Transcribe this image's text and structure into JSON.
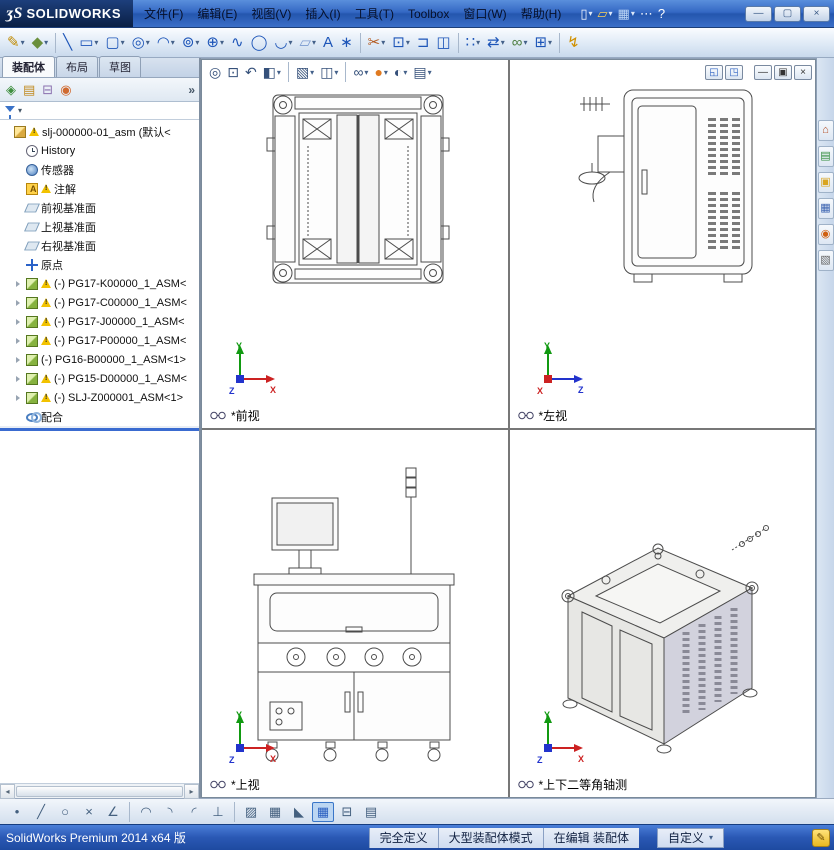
{
  "axis_colors": {
    "X": "#cc2222",
    "Y": "#119911",
    "Z": "#2233cc"
  },
  "titlebar": {
    "logo_mark": "ʒS",
    "logo_text": "SOLIDWORKS",
    "menus": [
      "文件(F)",
      "编辑(E)",
      "视图(V)",
      "插入(I)",
      "工具(T)",
      "Toolbox",
      "窗口(W)",
      "帮助(H)"
    ],
    "quick_icons": [
      {
        "name": "new-document-icon",
        "glyph": "▯",
        "color": "#f5f8ff",
        "caret": true
      },
      {
        "name": "open-document-icon",
        "glyph": "▱",
        "color": "#f7cf5a",
        "caret": true
      },
      {
        "name": "save-icon",
        "glyph": "▦",
        "color": "#bcd6f5",
        "caret": true
      },
      {
        "name": "more-commands-icon",
        "glyph": "⋯",
        "color": "#eaf1fc"
      },
      {
        "name": "help-icon",
        "glyph": "?",
        "color": "#ffffff"
      }
    ],
    "window_buttons": [
      {
        "name": "minimize-button",
        "glyph": "—"
      },
      {
        "name": "maximize-button",
        "glyph": "▢"
      },
      {
        "name": "close-button",
        "glyph": "×"
      }
    ]
  },
  "main_toolbar": {
    "icons": [
      {
        "name": "sketch-icon",
        "glyph": "✎",
        "color": "#c08a00",
        "caret": true
      },
      {
        "name": "dimension-icon",
        "glyph": "◆",
        "color": "#6a8f3c",
        "caret": true
      },
      {
        "sep": true
      },
      {
        "name": "line-icon",
        "glyph": "╲",
        "color": "#1d55b8"
      },
      {
        "name": "rectangle-icon",
        "glyph": "▭",
        "color": "#1d55b8",
        "caret": true
      },
      {
        "name": "slot-icon",
        "glyph": "▢",
        "color": "#1d55b8",
        "caret": true
      },
      {
        "name": "circle-icon",
        "glyph": "◎",
        "color": "#1d55b8",
        "caret": true
      },
      {
        "name": "arc-icon",
        "glyph": "◠",
        "color": "#1d55b8",
        "caret": true
      },
      {
        "name": "spiral-icon",
        "glyph": "⊚",
        "color": "#1d55b8",
        "caret": true
      },
      {
        "name": "perimeter-circle-icon",
        "glyph": "⊕",
        "color": "#1d55b8",
        "caret": true
      },
      {
        "name": "spline-icon",
        "glyph": "∿",
        "color": "#1d55b8"
      },
      {
        "name": "ellipse-icon",
        "glyph": "◯",
        "color": "#1d55b8"
      },
      {
        "name": "fillet-icon",
        "glyph": "◡",
        "color": "#1d55b8",
        "caret": true
      },
      {
        "name": "plane-icon",
        "glyph": "▱",
        "color": "#7a9ad0",
        "caret": true
      },
      {
        "name": "text-icon",
        "glyph": "A",
        "color": "#1d55b8"
      },
      {
        "name": "point-icon",
        "glyph": "∗",
        "color": "#1d55b8"
      },
      {
        "sep": true
      },
      {
        "name": "trim-icon",
        "glyph": "✂",
        "color": "#b35a20",
        "caret": true
      },
      {
        "name": "convert-entities-icon",
        "glyph": "⊡",
        "color": "#1d55b8",
        "caret": true
      },
      {
        "name": "offset-icon",
        "glyph": "⊐",
        "color": "#1d55b8"
      },
      {
        "name": "mirror-icon",
        "glyph": "◫",
        "color": "#1d55b8"
      },
      {
        "sep": true
      },
      {
        "name": "linear-pattern-icon",
        "glyph": "∷",
        "color": "#1d55b8",
        "caret": true
      },
      {
        "name": "move-entities-icon",
        "glyph": "⇄",
        "color": "#1d55b8",
        "caret": true
      },
      {
        "name": "display-relations-icon",
        "glyph": "∞",
        "color": "#4a7c3f",
        "caret": true
      },
      {
        "name": "quick-snaps-icon",
        "glyph": "⊞",
        "color": "#1d55b8",
        "caret": true
      },
      {
        "sep": true
      },
      {
        "name": "rapid-sketch-icon",
        "glyph": "↯",
        "color": "#d09000"
      }
    ]
  },
  "left_panel": {
    "tabs": [
      "装配体",
      "布局",
      "草图"
    ],
    "overflow": "»",
    "mini_icons": [
      {
        "name": "feature-manager-icon",
        "glyph": "◈",
        "color": "#3f8f3f"
      },
      {
        "name": "property-manager-icon",
        "glyph": "▤",
        "color": "#c08a20"
      },
      {
        "name": "configuration-manager-icon",
        "glyph": "⊟",
        "color": "#8a6fae"
      },
      {
        "name": "display-manager-icon",
        "glyph": "◉",
        "color": "#d06a30"
      }
    ]
  },
  "tree": {
    "rows": [
      {
        "label": "slj-000000-01_asm (默认<",
        "icon": "assembly-root",
        "warning": true,
        "expand": false,
        "indent": 0
      },
      {
        "label": "History",
        "icon": "history",
        "warning": false,
        "expand": false,
        "indent": 1
      },
      {
        "label": "传感器",
        "icon": "sensors",
        "warning": false,
        "expand": false,
        "indent": 1
      },
      {
        "label": "注解",
        "icon": "annotations",
        "warning": true,
        "expand": false,
        "indent": 1
      },
      {
        "label": "前视基准面",
        "icon": "plane",
        "warning": false,
        "expand": false,
        "indent": 1
      },
      {
        "label": "上视基准面",
        "icon": "plane",
        "warning": false,
        "expand": false,
        "indent": 1
      },
      {
        "label": "右视基准面",
        "icon": "plane",
        "warning": false,
        "expand": false,
        "indent": 1
      },
      {
        "label": "原点",
        "icon": "origin",
        "warning": false,
        "expand": false,
        "indent": 1
      },
      {
        "label": "(-) PG17-K00000_1_ASM<",
        "icon": "component",
        "warning": true,
        "expand": true,
        "indent": 1
      },
      {
        "label": "(-) PG17-C00000_1_ASM<",
        "icon": "component",
        "warning": true,
        "expand": true,
        "indent": 1
      },
      {
        "label": "(-) PG17-J00000_1_ASM<",
        "icon": "component",
        "warning": true,
        "expand": true,
        "indent": 1
      },
      {
        "label": "(-) PG17-P00000_1_ASM<",
        "icon": "component",
        "warning": true,
        "expand": true,
        "indent": 1
      },
      {
        "label": "(-) PG16-B00000_1_ASM<1>",
        "icon": "component",
        "warning": false,
        "expand": true,
        "indent": 1
      },
      {
        "label": "(-) PG15-D00000_1_ASM<",
        "icon": "component",
        "warning": true,
        "expand": true,
        "indent": 1
      },
      {
        "label": "(-) SLJ-Z000001_ASM<1>",
        "icon": "component",
        "warning": true,
        "expand": true,
        "indent": 1
      },
      {
        "label": "配合",
        "icon": "mates",
        "warning": false,
        "expand": false,
        "indent": 1
      }
    ]
  },
  "viewport": {
    "toolbar_icons": [
      {
        "name": "zoom-fit-icon",
        "glyph": "◎",
        "color": "#35507a"
      },
      {
        "name": "zoom-area-icon",
        "glyph": "⊡",
        "color": "#35507a"
      },
      {
        "name": "previous-view-icon",
        "glyph": "↶",
        "color": "#35507a"
      },
      {
        "name": "section-view-icon",
        "glyph": "◧",
        "color": "#35507a",
        "caret": true
      },
      {
        "sep": true
      },
      {
        "name": "view-orientation-icon",
        "glyph": "▧",
        "color": "#35507a",
        "caret": true
      },
      {
        "name": "display-style-icon",
        "glyph": "◫",
        "color": "#35507a",
        "caret": true
      },
      {
        "sep": true
      },
      {
        "name": "hide-show-icon",
        "glyph": "∞",
        "color": "#35507a",
        "caret": true
      },
      {
        "name": "edit-appearance-icon",
        "glyph": "●",
        "color": "#e07a20",
        "caret": true
      },
      {
        "name": "apply-scene-icon",
        "glyph": "◐",
        "color": "#35507a",
        "caret": true
      },
      {
        "name": "view-settings-icon",
        "glyph": "▤",
        "color": "#35507a",
        "caret": true
      }
    ],
    "window_icons": [
      {
        "name": "viewport-previous-icon",
        "glyph": "◱",
        "color": "#2a5fc0"
      },
      {
        "name": "viewport-four-view-icon",
        "glyph": "◳",
        "color": "#2a5fc0"
      },
      {
        "sep": true
      },
      {
        "name": "doc-minimize-icon",
        "glyph": "—",
        "color": "#333333"
      },
      {
        "name": "doc-restore-icon",
        "glyph": "▣",
        "color": "#333333"
      },
      {
        "name": "doc-close-icon",
        "glyph": "×",
        "color": "#333333"
      }
    ]
  },
  "views": [
    {
      "label": "*前视",
      "triad": {
        "up": "Y",
        "right": "X",
        "third": "Z"
      }
    },
    {
      "label": "*左视",
      "triad": {
        "up": "Y",
        "right": "Z",
        "third": "X"
      }
    },
    {
      "label": "*上视",
      "triad": {
        "up": "Y",
        "right": "X",
        "third": "Z"
      }
    },
    {
      "label": "*上下二等角轴测",
      "triad": {
        "up": "Y",
        "right": "X",
        "third": "Z"
      }
    }
  ],
  "task_pane": {
    "icons": [
      {
        "name": "resources-home-icon",
        "glyph": "⌂",
        "color": "#b34a20"
      },
      {
        "name": "design-library-icon",
        "glyph": "▤",
        "color": "#2e8b3a"
      },
      {
        "name": "file-explorer-icon",
        "glyph": "▣",
        "color": "#d9a520"
      },
      {
        "name": "view-palette-icon",
        "glyph": "▦",
        "color": "#3a62b0"
      },
      {
        "name": "appearances-icon",
        "glyph": "◉",
        "color": "#d06010"
      },
      {
        "name": "custom-properties-icon",
        "glyph": "▧",
        "color": "#666666"
      }
    ]
  },
  "bottom_toolbar": {
    "icons": [
      {
        "name": "sketch-point-icon",
        "glyph": "•",
        "color": "#44607f"
      },
      {
        "name": "sketch-line-icon",
        "glyph": "╱",
        "color": "#44607f"
      },
      {
        "name": "sketch-circle-icon",
        "glyph": "○",
        "color": "#44607f"
      },
      {
        "name": "sketch-erase-icon",
        "glyph": "×",
        "color": "#44607f"
      },
      {
        "name": "sketch-angle-icon",
        "glyph": "∠",
        "color": "#44607f"
      },
      {
        "sep": true
      },
      {
        "name": "arc-tool-icon",
        "glyph": "◠",
        "color": "#44607f"
      },
      {
        "name": "tangent-arc-icon",
        "glyph": "◝",
        "color": "#44607f"
      },
      {
        "name": "three-point-arc-icon",
        "glyph": "◜",
        "color": "#44607f"
      },
      {
        "name": "perpendicular-icon",
        "glyph": "⊥",
        "color": "#44607f"
      },
      {
        "sep": true
      },
      {
        "name": "hatch-icon",
        "glyph": "▨",
        "color": "#44607f"
      },
      {
        "name": "grid-icon",
        "glyph": "▦",
        "color": "#44607f"
      },
      {
        "name": "corner-icon",
        "glyph": "◣",
        "color": "#44607f"
      },
      {
        "name": "viewport-grid-icon",
        "glyph": "▦",
        "color": "#2a5fc0",
        "pressed": true
      },
      {
        "name": "split-horizontal-icon",
        "glyph": "⊟",
        "color": "#44607f"
      },
      {
        "name": "table-icon",
        "glyph": "▤",
        "color": "#44607f"
      }
    ]
  },
  "statusbar": {
    "left": "SolidWorks Premium 2014 x64 版",
    "cells": [
      "完全定义",
      "大型装配体模式",
      "在编辑 装配体"
    ],
    "custom": "自定义",
    "tag_glyph": "✎"
  }
}
